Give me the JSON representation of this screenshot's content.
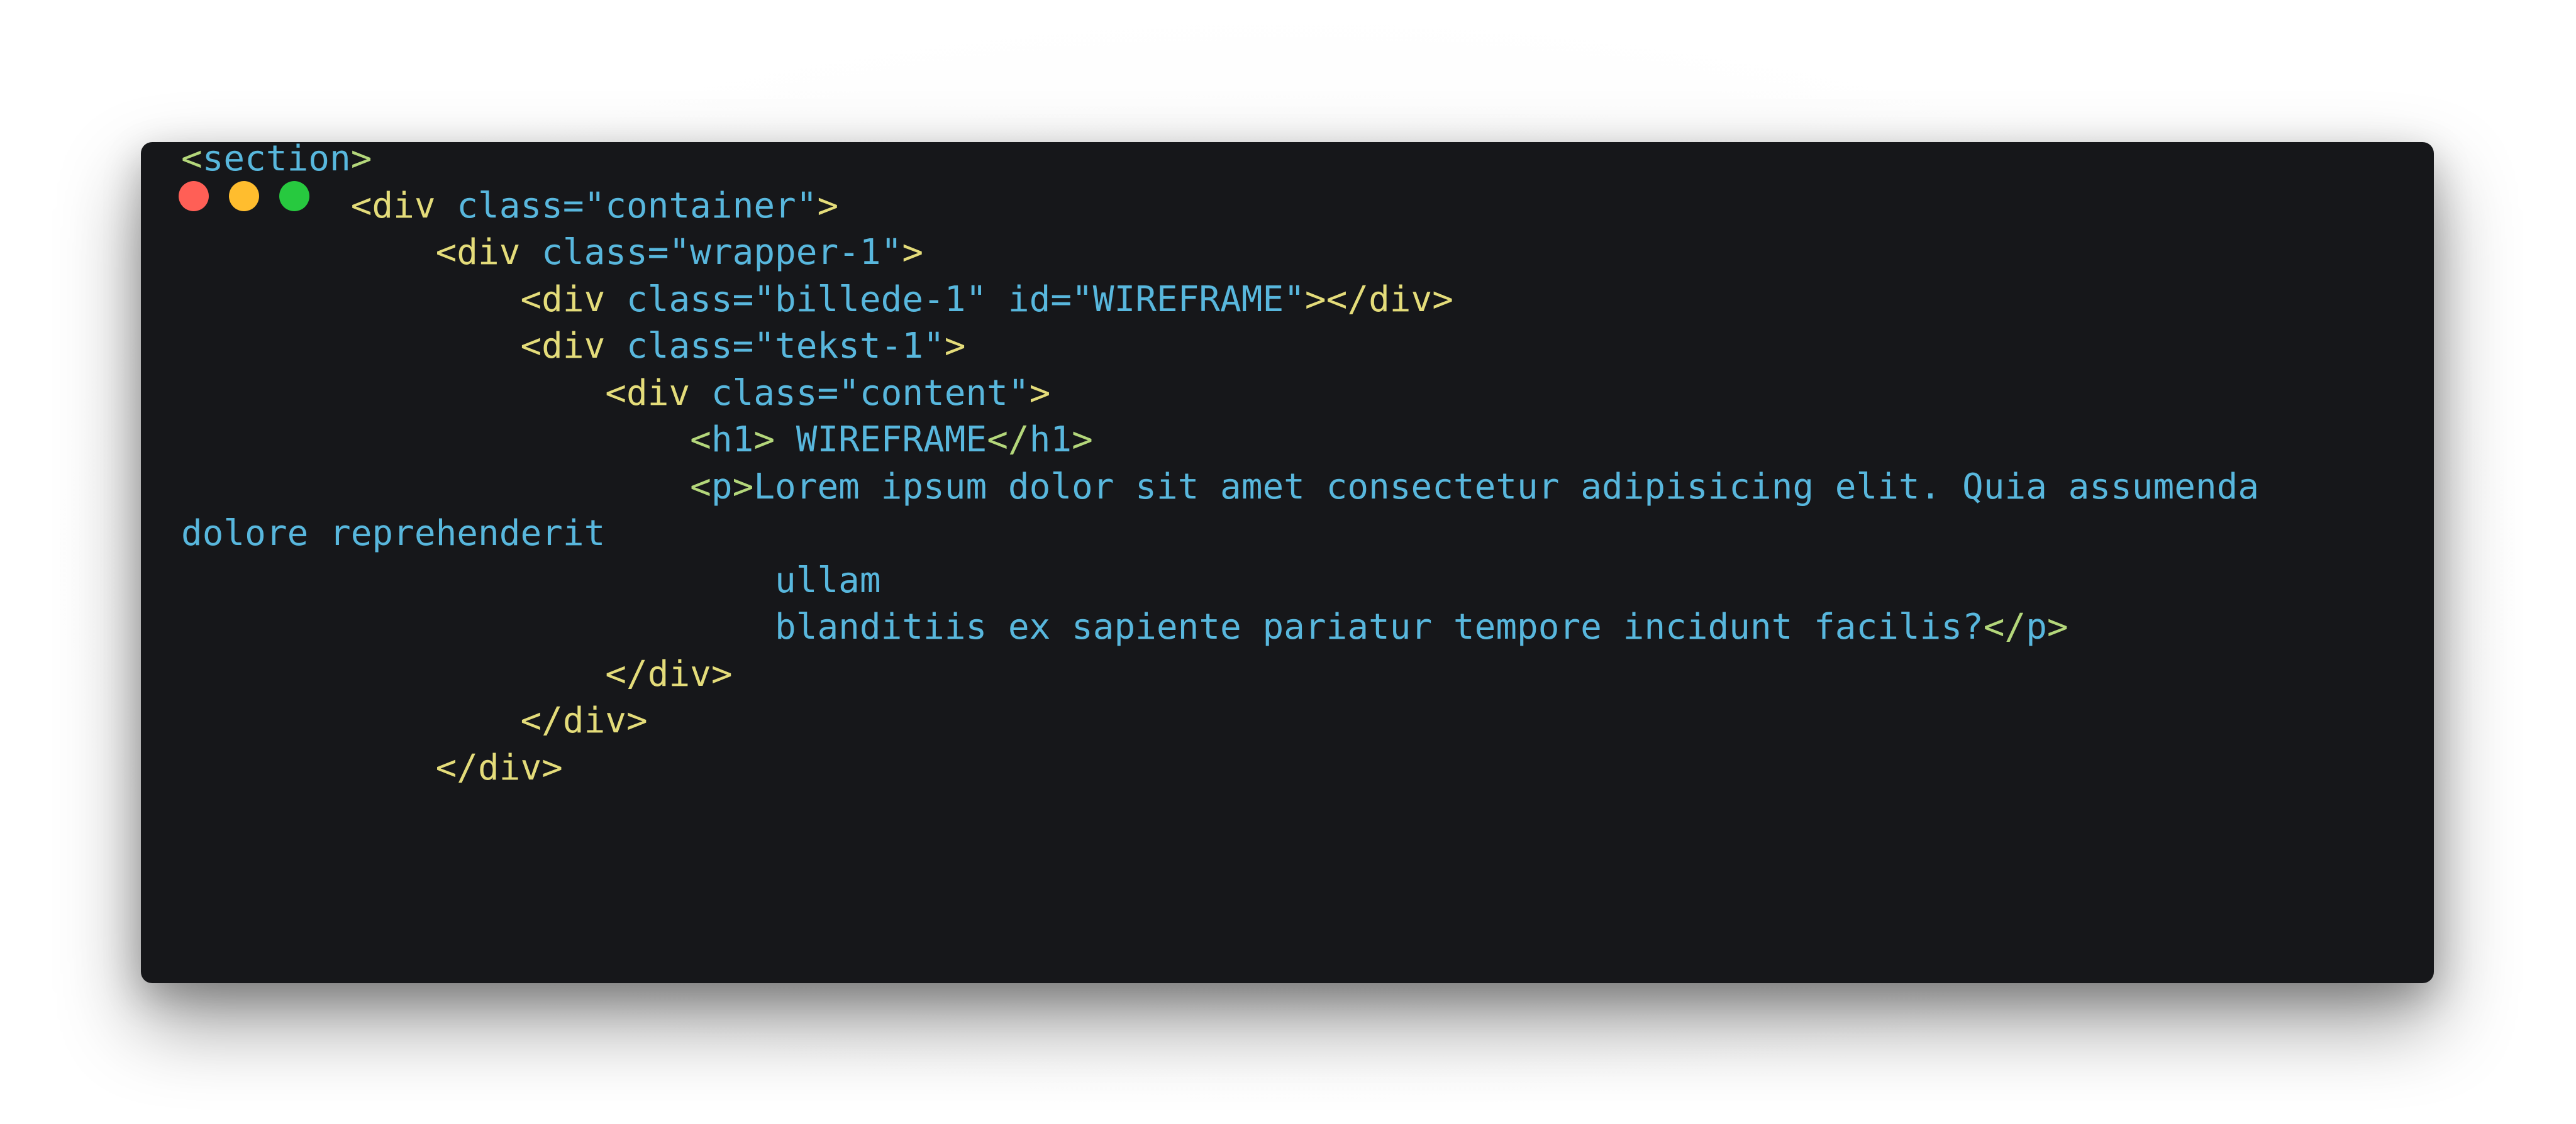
{
  "window": {
    "controls": {
      "close_color": "#ff5f56",
      "minimize_color": "#ffbd2e",
      "maximize_color": "#27c93f"
    },
    "background": "#16171a"
  },
  "code": {
    "lines": [
      {
        "indent": "",
        "parts": [
          [
            "g",
            "<"
          ],
          [
            "b",
            "section"
          ],
          [
            "g",
            ">"
          ]
        ]
      },
      {
        "indent": "        ",
        "parts": [
          [
            "y",
            "<div"
          ],
          [
            "b",
            " class="
          ],
          [
            "b",
            "\"container\""
          ],
          [
            "y",
            ">"
          ]
        ]
      },
      {
        "indent": "            ",
        "parts": [
          [
            "y",
            "<div"
          ],
          [
            "b",
            " class="
          ],
          [
            "b",
            "\"wrapper-1\""
          ],
          [
            "y",
            ">"
          ]
        ]
      },
      {
        "indent": "                ",
        "parts": [
          [
            "y",
            "<div"
          ],
          [
            "b",
            " class="
          ],
          [
            "b",
            "\"billede-1\""
          ],
          [
            "b",
            " id="
          ],
          [
            "b",
            "\"WIREFRAME\""
          ],
          [
            "y",
            "></div>"
          ]
        ]
      },
      {
        "indent": "                ",
        "parts": [
          [
            "y",
            "<div"
          ],
          [
            "b",
            " class="
          ],
          [
            "b",
            "\"tekst-1\""
          ],
          [
            "y",
            ">"
          ]
        ]
      },
      {
        "indent": "                    ",
        "parts": [
          [
            "y",
            "<div"
          ],
          [
            "b",
            " class="
          ],
          [
            "b",
            "\"content\""
          ],
          [
            "y",
            ">"
          ]
        ]
      },
      {
        "indent": "                        ",
        "parts": [
          [
            "g",
            "<"
          ],
          [
            "b",
            "h1"
          ],
          [
            "g",
            ">"
          ],
          [
            "b",
            " WIREFRAME"
          ],
          [
            "g",
            "</"
          ],
          [
            "b",
            "h1"
          ],
          [
            "g",
            ">"
          ]
        ]
      },
      {
        "indent": "                        ",
        "parts": [
          [
            "g",
            "<"
          ],
          [
            "b",
            "p"
          ],
          [
            "g",
            ">"
          ],
          [
            "b",
            "Lorem ipsum dolor sit amet consectetur adipisicing elit. Quia assumenda"
          ]
        ]
      },
      {
        "indent": "",
        "parts": [
          [
            "b",
            "dolore reprehenderit"
          ]
        ]
      },
      {
        "indent": "                            ",
        "parts": [
          [
            "b",
            "ullam"
          ]
        ]
      },
      {
        "indent": "                            ",
        "parts": [
          [
            "b",
            "blanditiis ex sapiente pariatur tempore incidunt facilis?"
          ],
          [
            "g",
            "</"
          ],
          [
            "b",
            "p"
          ],
          [
            "g",
            ">"
          ]
        ]
      },
      {
        "indent": "                    ",
        "parts": [
          [
            "y",
            "</div>"
          ]
        ]
      },
      {
        "indent": "                ",
        "parts": [
          [
            "y",
            "</div>"
          ]
        ]
      },
      {
        "indent": "            ",
        "parts": [
          [
            "y",
            "</div>"
          ]
        ]
      }
    ]
  }
}
